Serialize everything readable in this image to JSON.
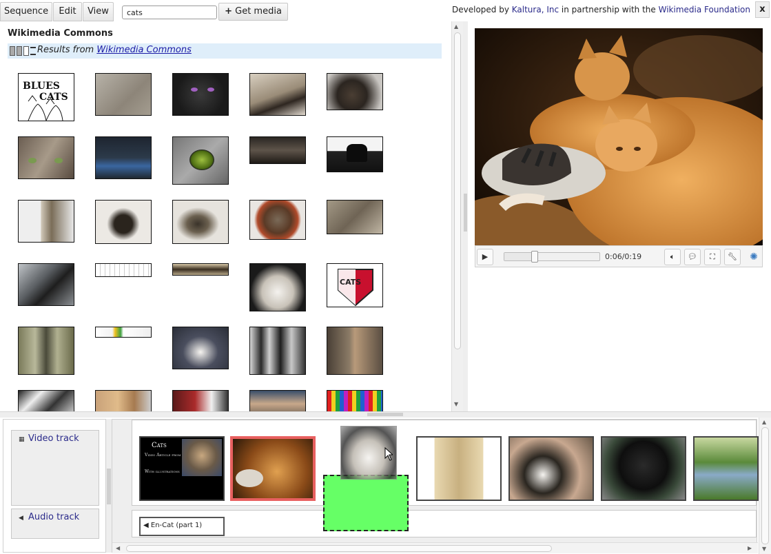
{
  "menu": {
    "sequence": "Sequence",
    "edit": "Edit",
    "view": "View"
  },
  "search": {
    "value": "cats"
  },
  "get_media": {
    "label": "Get media",
    "icon": "plus-icon"
  },
  "credit": {
    "prefix": "Developed by ",
    "kaltura": "Kaltura, Inc",
    "middle": " in partnership with the ",
    "wikimedia": "Wikimedia Foundation"
  },
  "close_label": "x",
  "media_panel": {
    "title": "Wikimedia Commons",
    "results_prefix": "Results from ",
    "results_link": "Wikimedia Commons"
  },
  "player": {
    "time": "0:06/0:19",
    "progress": 0.32
  },
  "tracks": {
    "video": "Video track",
    "audio": "Audio track"
  },
  "clips": {
    "title_card_line1": "Cats",
    "title_card_line2": "Video Article from",
    "title_card_line3": "With illustrations"
  },
  "audio_clip": "En-Cat (part 1)",
  "colors": {
    "selected_clip": "#e86060",
    "drop_zone": "#66ff66",
    "link": "#1a1aa6"
  }
}
